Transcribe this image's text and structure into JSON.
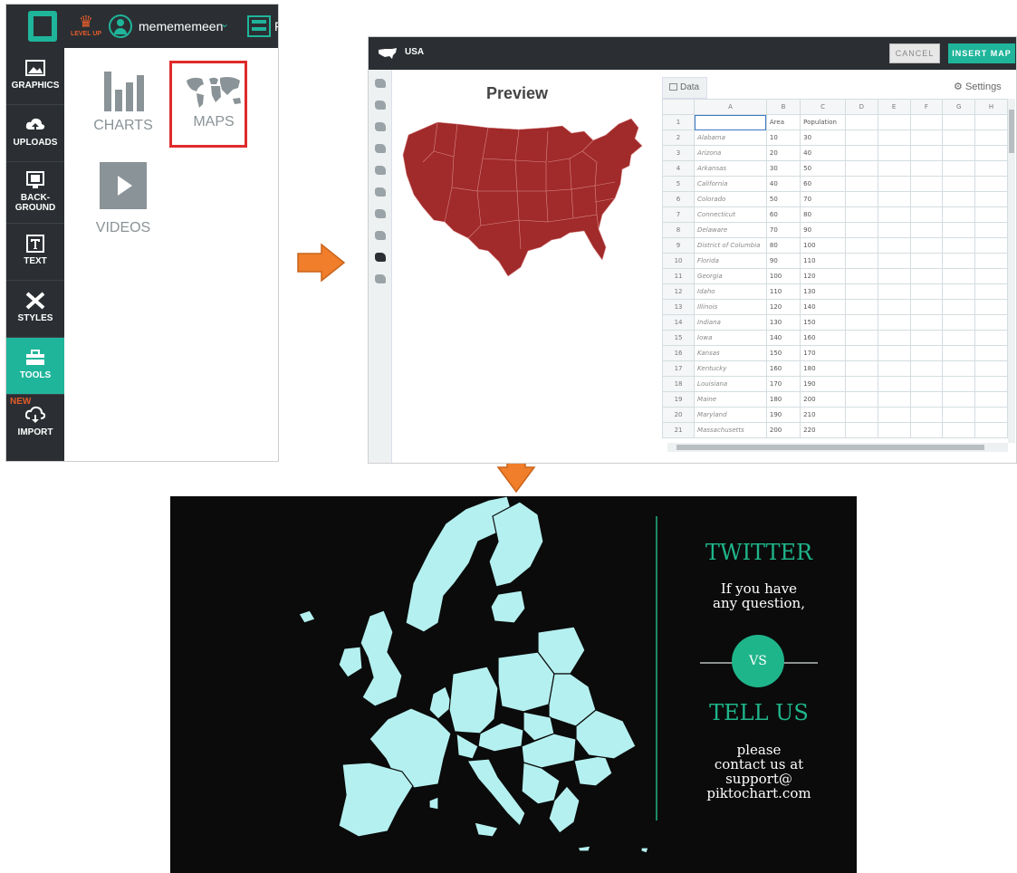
{
  "editor": {
    "brand_icon": "piktochart-logo-icon",
    "level_up": "LEVEL UP",
    "username": "memememeen",
    "edge_text": "F",
    "sidebar": [
      {
        "label": "GRAPHICS",
        "icon": "image-icon"
      },
      {
        "label": "UPLOADS",
        "icon": "cloud-upload-icon"
      },
      {
        "label": "BACK-\nGROUND",
        "icon": "background-icon"
      },
      {
        "label": "TEXT",
        "icon": "text-icon"
      },
      {
        "label": "STYLES",
        "icon": "styles-icon"
      },
      {
        "label": "TOOLS",
        "icon": "toolbox-icon",
        "active": true
      },
      {
        "label": "IMPORT",
        "icon": "cloud-import-icon",
        "badge": "NEW"
      }
    ],
    "tools": [
      {
        "label": "CHARTS",
        "icon": "bar-chart-icon"
      },
      {
        "label": "MAPS",
        "icon": "world-map-icon",
        "highlighted": true
      },
      {
        "label": "VIDEOS",
        "icon": "play-icon"
      }
    ]
  },
  "map_editor": {
    "title": "USA",
    "cancel_label": "CANCEL",
    "insert_label": "INSERT MAP",
    "preview_title": "Preview",
    "data_tab": "Data",
    "settings_label": "Settings",
    "map_color": "#a12a2a",
    "columns": [
      "A",
      "B",
      "C",
      "D",
      "E",
      "F",
      "G",
      "H"
    ],
    "rows": [
      [
        "",
        "Area",
        "Population"
      ],
      [
        "Alabama",
        "10",
        "30"
      ],
      [
        "Arizona",
        "20",
        "40"
      ],
      [
        "Arkansas",
        "30",
        "50"
      ],
      [
        "California",
        "40",
        "60"
      ],
      [
        "Colorado",
        "50",
        "70"
      ],
      [
        "Connecticut",
        "60",
        "80"
      ],
      [
        "Delaware",
        "70",
        "90"
      ],
      [
        "District of Columbia",
        "80",
        "100"
      ],
      [
        "Florida",
        "90",
        "110"
      ],
      [
        "Georgia",
        "100",
        "120"
      ],
      [
        "Idaho",
        "110",
        "130"
      ],
      [
        "Illinois",
        "120",
        "140"
      ],
      [
        "Indiana",
        "130",
        "150"
      ],
      [
        "Iowa",
        "140",
        "160"
      ],
      [
        "Kansas",
        "150",
        "170"
      ],
      [
        "Kentucky",
        "160",
        "180"
      ],
      [
        "Louisiana",
        "170",
        "190"
      ],
      [
        "Maine",
        "180",
        "200"
      ],
      [
        "Maryland",
        "190",
        "210"
      ],
      [
        "Massachusetts",
        "200",
        "220"
      ]
    ]
  },
  "infographic": {
    "map_color": "#b5f0f0",
    "accent_color": "#1fb58a",
    "twitter_title": "TWITTER",
    "twitter_text": "If you have\nany question,",
    "vs_label": "VS",
    "tellus_title": "TELL US",
    "tellus_text": "please\ncontact us at\nsupport@\npiktochart.com"
  }
}
